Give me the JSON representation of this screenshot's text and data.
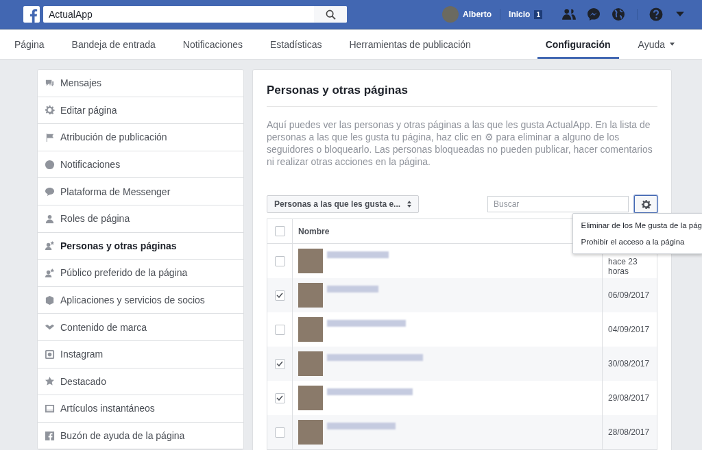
{
  "top_bar": {
    "search": {
      "value": "ActualApp"
    },
    "user": "Alberto",
    "home": "Inicio",
    "home_count": "1"
  },
  "page_tabs": [
    {
      "label": "Página",
      "selected": false
    },
    {
      "label": "Bandeja de entrada",
      "selected": false
    },
    {
      "label": "Notificaciones",
      "selected": false
    },
    {
      "label": "Estadísticas",
      "selected": false
    },
    {
      "label": "Herramientas de publicación",
      "selected": false
    },
    {
      "label": "Configuración",
      "selected": true
    },
    {
      "label": "Ayuda",
      "selected": false,
      "dropdown": true
    }
  ],
  "sidebar": {
    "items": [
      {
        "label": "Mensajes",
        "selected": false
      },
      {
        "label": "Editar página",
        "selected": false
      },
      {
        "label": "Atribución de publicación",
        "selected": false
      },
      {
        "label": "Notificaciones",
        "selected": false
      },
      {
        "label": "Plataforma de Messenger",
        "selected": false
      },
      {
        "label": "Roles de página",
        "selected": false
      },
      {
        "label": "Personas y otras páginas",
        "selected": true
      },
      {
        "label": "Público preferido de la página",
        "selected": false
      },
      {
        "label": "Aplicaciones y servicios de socios",
        "selected": false
      },
      {
        "label": "Contenido de marca",
        "selected": false
      },
      {
        "label": "Instagram",
        "selected": false
      },
      {
        "label": "Destacado",
        "selected": false
      },
      {
        "label": "Artículos instantáneos",
        "selected": false
      },
      {
        "label": "Buzón de ayuda de la página",
        "selected": false
      }
    ]
  },
  "main": {
    "title": "Personas y otras páginas",
    "description": "Aquí puedes ver las personas y otras páginas a las que les gusta ActualApp. En la lista de personas a las que les gusta tu página, haz clic en ⚙ para eliminar a alguno de los seguidores o bloquearlo. Las personas bloqueadas no pueden publicar, hacer comentarios ni realizar otras acciones en la página.",
    "filter": "Personas a las que les gusta e...",
    "search": {
      "placeholder": "Buscar"
    },
    "menu": {
      "open": true,
      "items": [
        "Eliminar de los Me gusta de la pág",
        "Prohibir el acceso a la página"
      ]
    },
    "table": {
      "columns": [
        "Nombre"
      ],
      "all_checked": false,
      "rows": [
        {
          "checked": false,
          "date": "hace 23 horas"
        },
        {
          "checked": true,
          "date": "06/09/2017"
        },
        {
          "checked": false,
          "date": "04/09/2017"
        },
        {
          "checked": true,
          "date": "30/08/2017"
        },
        {
          "checked": true,
          "date": "29/08/2017"
        },
        {
          "checked": false,
          "date": "28/08/2017"
        }
      ]
    }
  }
}
